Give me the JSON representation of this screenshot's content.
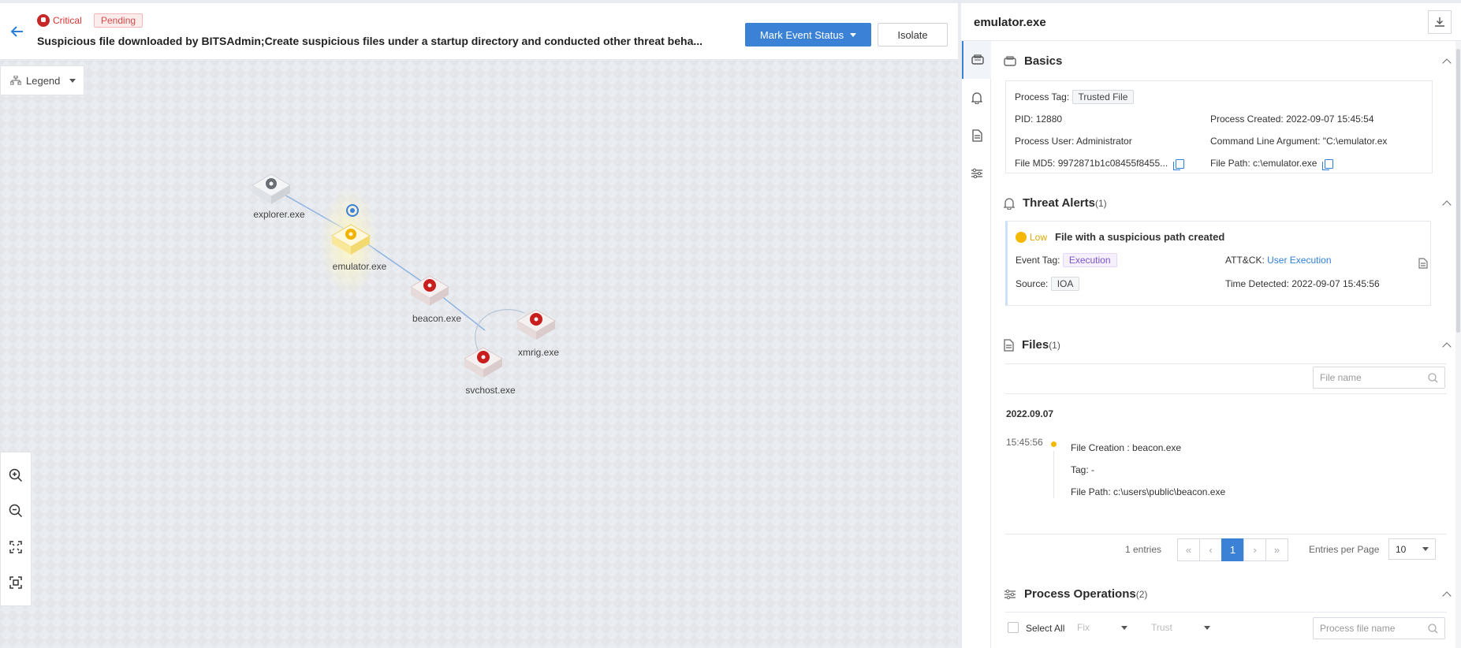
{
  "header": {
    "severity": "Critical",
    "status": "Pending",
    "title": "Suspicious file downloaded by BITSAdmin;Create suspicious files under a startup directory and conducted other threat beha...",
    "mark_button": "Mark Event Status",
    "isolate_button": "Isolate"
  },
  "canvas": {
    "legend_label": "Legend",
    "nodes": [
      {
        "id": "explorer",
        "label": "explorer.exe",
        "kind": "gear-gray"
      },
      {
        "id": "emulator",
        "label": "emulator.exe",
        "kind": "gear-yellow-selected"
      },
      {
        "id": "beacon",
        "label": "beacon.exe",
        "kind": "gear-red"
      },
      {
        "id": "xmrig",
        "label": "xmrig.exe",
        "kind": "gear-red"
      },
      {
        "id": "svchost",
        "label": "svchost.exe",
        "kind": "gear-red"
      }
    ],
    "tools": [
      "zoom-in-icon",
      "zoom-out-icon",
      "fit-screen-icon",
      "focus-icon"
    ]
  },
  "panel": {
    "title": "emulator.exe",
    "basics": {
      "heading": "Basics",
      "process_tag_label": "Process Tag:",
      "process_tag_value": "Trusted File",
      "pid_label": "PID:",
      "pid_value": "12880",
      "created_label": "Process Created:",
      "created_value": "2022-09-07 15:45:54",
      "user_label": "Process User:",
      "user_value": "Administrator",
      "cmd_label": "Command Line Argument:",
      "cmd_value": "\"C:\\emulator.ex",
      "md5_label": "File MD5:",
      "md5_value": "9972871b1c08455f8455...",
      "path_label": "File Path:",
      "path_value": "c:\\emulator.exe"
    },
    "alerts": {
      "heading": "Threat Alerts",
      "count": "(1)",
      "level": "Low",
      "alert_title": "File with a suspicious path created",
      "event_tag_label": "Event Tag:",
      "event_tag_value": "Execution",
      "attck_label": "ATT&CK:",
      "attck_value": "User Execution",
      "source_label": "Source:",
      "source_value": "IOA",
      "time_label": "Time Detected:",
      "time_value": "2022-09-07 15:45:56"
    },
    "files": {
      "heading": "Files",
      "count": "(1)",
      "search_placeholder": "File name",
      "date": "2022.09.07",
      "time": "15:45:56",
      "creation_label": "File Creation :",
      "creation_value": "beacon.exe",
      "tag_label": "Tag:",
      "tag_value": "-",
      "path_label": "File Path:",
      "path_value": "c:\\users\\public\\beacon.exe",
      "entries": "1 entries",
      "page": "1",
      "per_page_label": "Entries per Page",
      "per_page_value": "10"
    },
    "operations": {
      "heading": "Process Operations",
      "count": "(2)",
      "select_all": "Select All",
      "fix_label": "Fix",
      "trust_label": "Trust",
      "search_placeholder": "Process file name"
    }
  }
}
